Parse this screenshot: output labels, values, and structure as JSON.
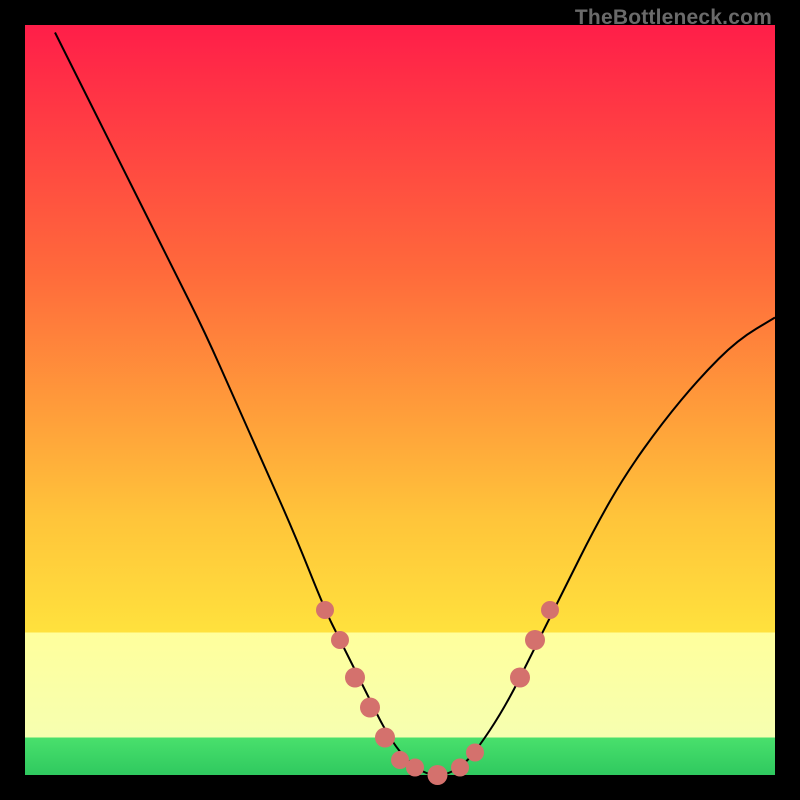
{
  "watermark": "TheBottleneck.com",
  "chart_data": {
    "type": "line",
    "title": "",
    "xlabel": "",
    "ylabel": "",
    "xlim": [
      0,
      100
    ],
    "ylim": [
      0,
      100
    ],
    "grid": false,
    "series": [
      {
        "name": "curve",
        "color": "#000000",
        "x": [
          4,
          8,
          12,
          16,
          20,
          24,
          28,
          32,
          36,
          40,
          42,
          44,
          46,
          48,
          50,
          52,
          54,
          56,
          58,
          60,
          64,
          68,
          72,
          76,
          80,
          85,
          90,
          95,
          100
        ],
        "y": [
          99,
          91,
          83,
          75,
          67,
          59,
          50,
          41,
          32,
          22,
          18,
          14,
          10,
          6,
          3,
          1,
          0,
          0,
          1,
          3,
          9,
          17,
          25,
          33,
          40,
          47,
          53,
          58,
          61
        ]
      }
    ],
    "markers": [
      {
        "x": 40,
        "y": 22,
        "color": "#d4716d",
        "r": 9
      },
      {
        "x": 42,
        "y": 18,
        "color": "#d4716d",
        "r": 9
      },
      {
        "x": 44,
        "y": 13,
        "color": "#d4716d",
        "r": 10
      },
      {
        "x": 46,
        "y": 9,
        "color": "#d4716d",
        "r": 10
      },
      {
        "x": 48,
        "y": 5,
        "color": "#d4716d",
        "r": 10
      },
      {
        "x": 50,
        "y": 2,
        "color": "#d4716d",
        "r": 9
      },
      {
        "x": 52,
        "y": 1,
        "color": "#d4716d",
        "r": 9
      },
      {
        "x": 55,
        "y": 0,
        "color": "#d4716d",
        "r": 10
      },
      {
        "x": 58,
        "y": 1,
        "color": "#d4716d",
        "r": 9
      },
      {
        "x": 60,
        "y": 3,
        "color": "#d4716d",
        "r": 9
      },
      {
        "x": 66,
        "y": 13,
        "color": "#d4716d",
        "r": 10
      },
      {
        "x": 68,
        "y": 18,
        "color": "#d4716d",
        "r": 10
      },
      {
        "x": 70,
        "y": 22,
        "color": "#d4716d",
        "r": 9
      }
    ]
  },
  "colors": {
    "gradient_top": "#ff1e49",
    "gradient_mid": "#ffc53a",
    "gradient_low": "#ffe93e",
    "pale_band": "#ffff9c",
    "green_band": "#2fc95f",
    "marker": "#d4716d",
    "curve": "#000000",
    "frame_bg": "#000000"
  }
}
